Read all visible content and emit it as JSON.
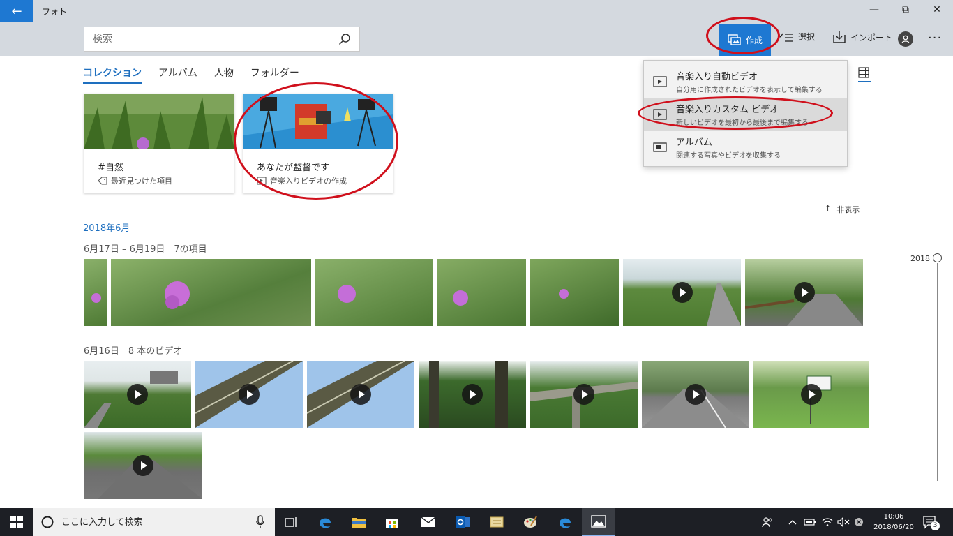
{
  "window": {
    "app_title": "フォト",
    "back_glyph": "←",
    "minimize_glyph": "—",
    "maximize_glyph": "⧉",
    "close_glyph": "✕"
  },
  "toolbar": {
    "search_placeholder": "検索",
    "create_label": "作成",
    "select_label": "選択",
    "import_label": "インポート",
    "more_glyph": "···"
  },
  "tabs": [
    {
      "label": "コレクション",
      "active": true
    },
    {
      "label": "アルバム",
      "active": false
    },
    {
      "label": "人物",
      "active": false
    },
    {
      "label": "フォルダー",
      "active": false
    }
  ],
  "cards": [
    {
      "name": "#自然",
      "sub": "最近見つけた項目",
      "icon": "tag-icon"
    },
    {
      "name": "あなたが監督です",
      "sub": "音楽入りビデオの作成",
      "icon": "video-icon"
    }
  ],
  "dropdown": {
    "items": [
      {
        "title": "音楽入り自動ビデオ",
        "sub": "自分用に作成されたビデオを表示して編集する",
        "icon": "auto-video-icon",
        "highlighted": false
      },
      {
        "title": "音楽入りカスタム ビデオ",
        "sub": "新しいビデオを最初から最後まで編集する",
        "icon": "custom-video-icon",
        "highlighted": true
      },
      {
        "title": "アルバム",
        "sub": "関連する写真やビデオを収集する",
        "icon": "album-icon",
        "highlighted": false
      }
    ]
  },
  "hide_label": "非表示",
  "hide_glyph": "↑",
  "month_title": "2018年6月",
  "groups": [
    {
      "title": "6月17日 – 6月19日　7の項目"
    },
    {
      "title": "6月16日　8 本のビデオ"
    }
  ],
  "timeline": {
    "year": "2018"
  },
  "taskbar": {
    "search_placeholder": "ここに入力して検索",
    "time": "10:06",
    "date": "2018/06/20",
    "notification_count": "3"
  },
  "colors": {
    "accent": "#1e78d2",
    "annotation": "#d0101c",
    "titlebar": "#d4d9df",
    "taskbar": "#1d1f25"
  }
}
